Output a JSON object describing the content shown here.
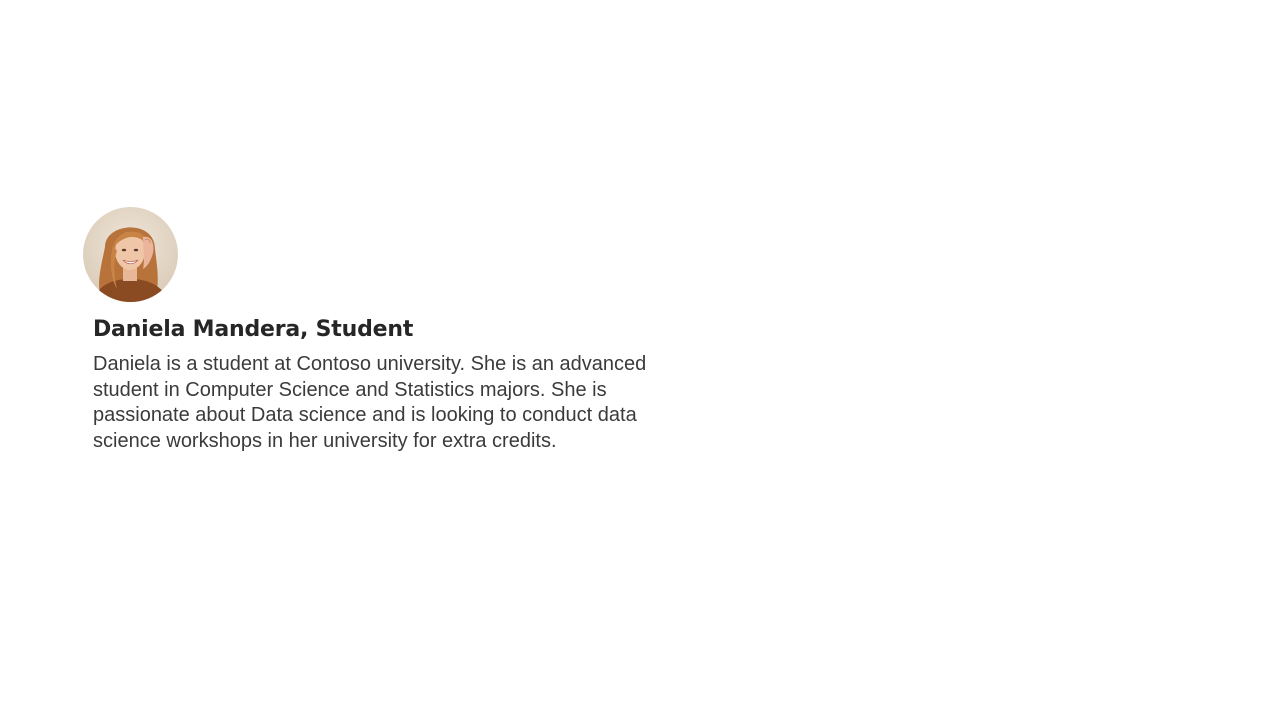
{
  "persona": {
    "name": "Daniela Mandera, Student",
    "description": "Daniela is a student at Contoso university. She is an advanced student in Computer Science and Statistics majors. She is passionate about Data science and is looking to conduct data science workshops in her university for extra credits.",
    "avatar_icon": "person-photo"
  },
  "colors": {
    "background": "#ffffff",
    "title_text": "#262626",
    "body_text": "#3b3b3b"
  }
}
